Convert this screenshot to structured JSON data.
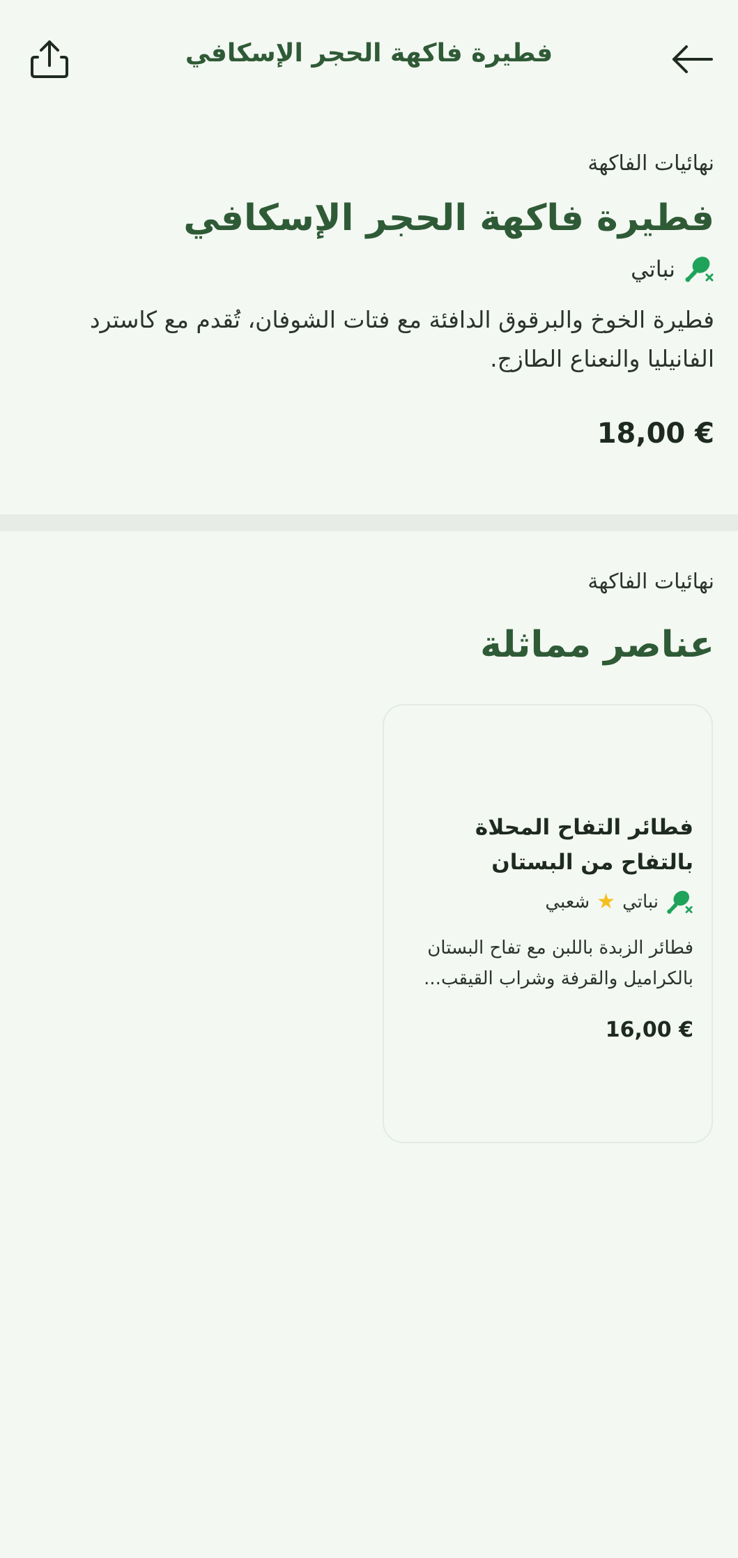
{
  "header": {
    "title": "فطيرة فاكهة الحجر الإسكافي"
  },
  "icons": {
    "share": "share-icon",
    "back": "arrow-left-icon",
    "vegan": "vegan-drumstick-icon",
    "star": "star-icon"
  },
  "detail": {
    "category": "نهائيات الفاكهة",
    "title": "فطيرة فاكهة الحجر الإسكافي",
    "tag": "نباتي",
    "description": "فطيرة الخوخ والبرقوق الدافئة مع فتات الشوفان، تُقدم مع كاسترد الفانيليا والنعناع الطازج.",
    "price": "18,00 €"
  },
  "similar": {
    "category": "نهائيات الفاكهة",
    "title": "عناصر مماثلة",
    "items": [
      {
        "title": "فطائر التفاح المحلاة بالتفاح من البستان",
        "tag_vegan": "نباتي",
        "tag_popular": "شعبي",
        "description": "فطائر الزبدة باللبن مع تفاح البستان بالكراميل والقرفة وشراب القيقب...",
        "price": "16,00 €"
      }
    ]
  },
  "colors": {
    "background": "#f3f8f2",
    "accent": "#2f5a36",
    "vegan_icon": "#1fa35a",
    "star": "#f5bf1f"
  }
}
